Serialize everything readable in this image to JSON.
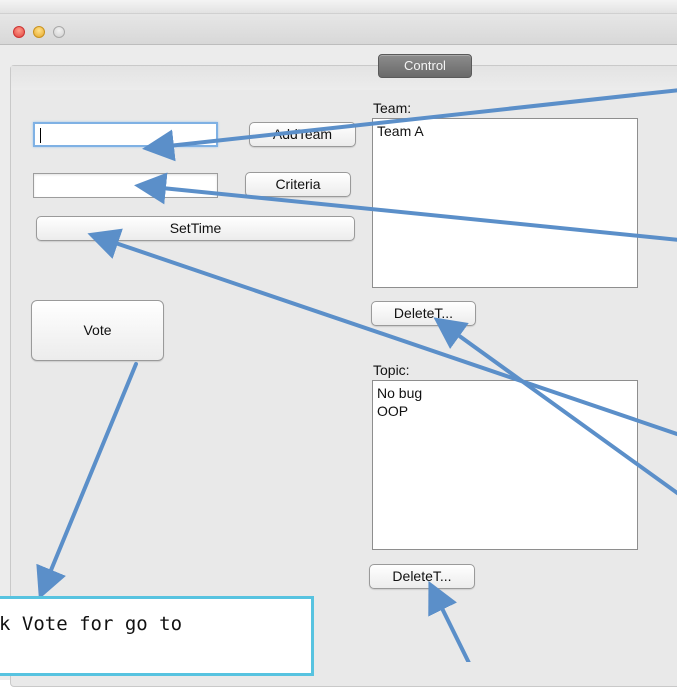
{
  "window": {
    "tab_label": "Control"
  },
  "control": {
    "team_input": {
      "value": ""
    },
    "criteria_input": {
      "value": ""
    },
    "add_team_label": "AddTeam",
    "criteria_label": "Criteria",
    "set_time_label": "SetTime",
    "vote_label": "Vote",
    "team_list": {
      "label": "Team:",
      "items": [
        "Team A"
      ],
      "delete_label": "DeleteT..."
    },
    "topic_list": {
      "label": "Topic:",
      "items": [
        "No bug",
        "OOP"
      ],
      "delete_label": "DeleteT..."
    }
  },
  "annotation": {
    "callout_text": "k Vote for go to",
    "arrow_color": "#5b8fc9"
  }
}
